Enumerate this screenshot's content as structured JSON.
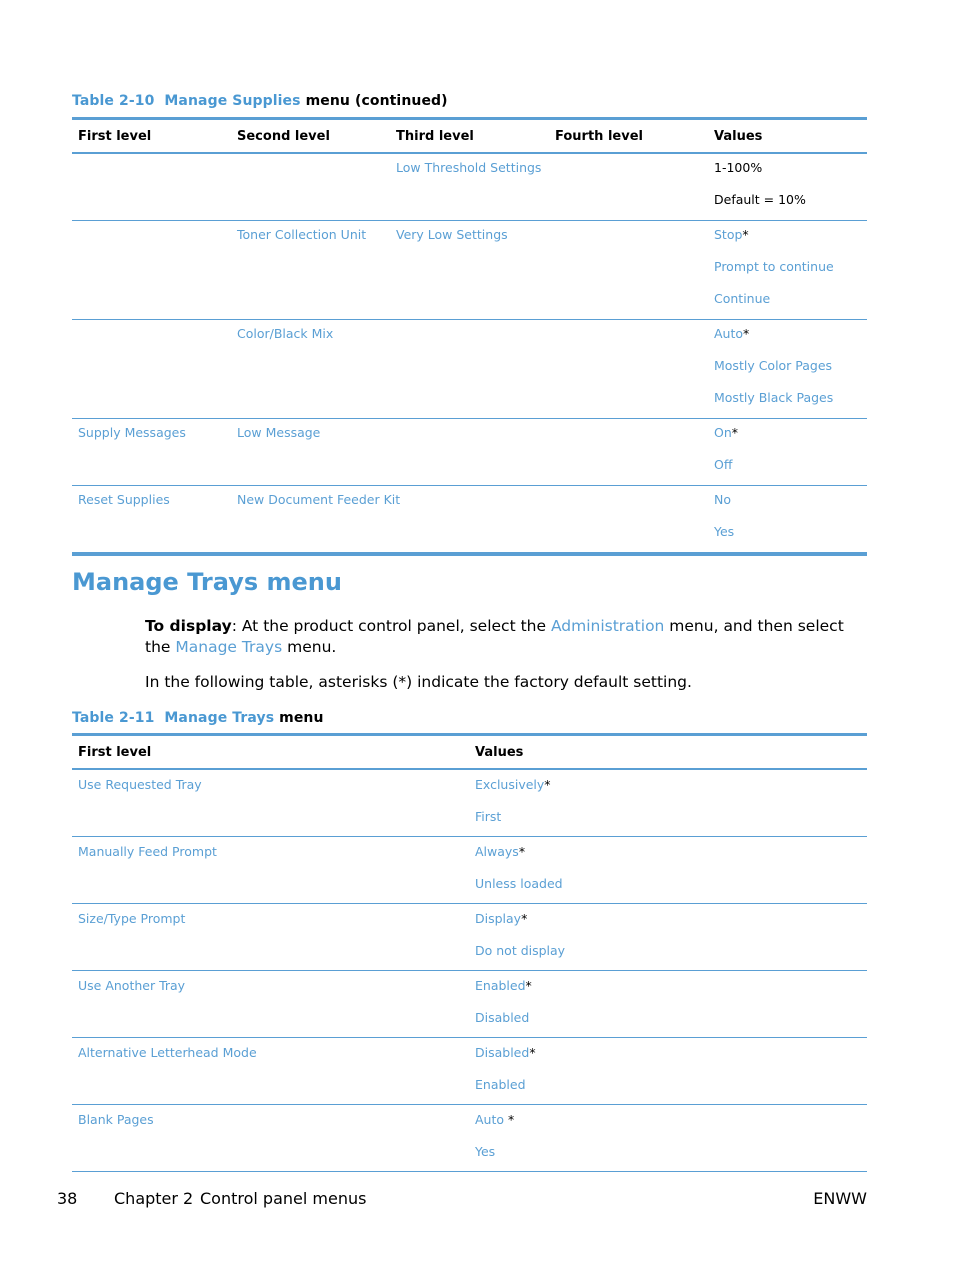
{
  "table1": {
    "caption_num": "Table 2-10",
    "caption_name": "Manage Supplies",
    "caption_rest": "menu (continued)",
    "headers": [
      "First level",
      "Second level",
      "Third level",
      "Fourth level",
      "Values"
    ],
    "groups": [
      {
        "first": "",
        "second": "",
        "third": "Low Threshold Settings",
        "fourth": "",
        "values": [
          {
            "text": "1-100%",
            "asterisk": "",
            "black": true
          },
          {
            "text": "Default = 10%",
            "asterisk": "",
            "black": true
          }
        ]
      },
      {
        "first": "",
        "second": "Toner Collection Unit",
        "third": "Very Low Settings",
        "fourth": "",
        "values": [
          {
            "text": "Stop",
            "asterisk": "*"
          },
          {
            "text": "Prompt to continue",
            "asterisk": ""
          },
          {
            "text": "Continue",
            "asterisk": ""
          }
        ]
      },
      {
        "first": "",
        "second": "Color/Black Mix",
        "third": "",
        "fourth": "",
        "values": [
          {
            "text": "Auto",
            "asterisk": "*"
          },
          {
            "text": "Mostly Color Pages",
            "asterisk": ""
          },
          {
            "text": "Mostly Black Pages",
            "asterisk": ""
          }
        ]
      },
      {
        "first": "Supply Messages",
        "second": "Low Message",
        "third": "",
        "fourth": "",
        "values": [
          {
            "text": "On",
            "asterisk": "*"
          },
          {
            "text": "Off",
            "asterisk": ""
          }
        ]
      },
      {
        "first": "Reset Supplies",
        "second": "New Document Feeder Kit",
        "third": "",
        "fourth": "",
        "values": [
          {
            "text": "No",
            "asterisk": ""
          },
          {
            "text": "Yes",
            "asterisk": ""
          }
        ]
      }
    ]
  },
  "section": {
    "title": "Manage Trays menu",
    "para1_bold": "To display",
    "para1_a": ": At the product control panel, select the ",
    "para1_link1": "Administration",
    "para1_b": " menu, and then select the ",
    "para1_link2": "Manage Trays",
    "para1_c": " menu.",
    "para2": "In the following table, asterisks (*) indicate the factory default setting."
  },
  "table2": {
    "caption_num": "Table 2-11",
    "caption_name": "Manage Trays",
    "caption_rest": "menu",
    "headers": [
      "First level",
      "Values"
    ],
    "groups": [
      {
        "first": "Use Requested Tray",
        "values": [
          {
            "text": "Exclusively",
            "asterisk": "*"
          },
          {
            "text": "First",
            "asterisk": ""
          }
        ]
      },
      {
        "first": "Manually Feed Prompt",
        "values": [
          {
            "text": "Always",
            "asterisk": "*"
          },
          {
            "text": "Unless loaded",
            "asterisk": ""
          }
        ]
      },
      {
        "first": "Size/Type Prompt",
        "values": [
          {
            "text": "Display",
            "asterisk": "*"
          },
          {
            "text": "Do not display",
            "asterisk": ""
          }
        ]
      },
      {
        "first": "Use Another Tray",
        "values": [
          {
            "text": "Enabled",
            "asterisk": "*"
          },
          {
            "text": "Disabled",
            "asterisk": ""
          }
        ]
      },
      {
        "first": "Alternative Letterhead Mode",
        "values": [
          {
            "text": "Disabled",
            "asterisk": "*"
          },
          {
            "text": "Enabled",
            "asterisk": ""
          }
        ]
      },
      {
        "first": "Blank Pages",
        "values": [
          {
            "text": "Auto ",
            "asterisk": "*"
          },
          {
            "text": "Yes",
            "asterisk": ""
          }
        ]
      }
    ]
  },
  "footer": {
    "page_number": "38",
    "chapter": "Chapter 2",
    "chapter_title": "Control panel menus",
    "right": "ENWW"
  }
}
